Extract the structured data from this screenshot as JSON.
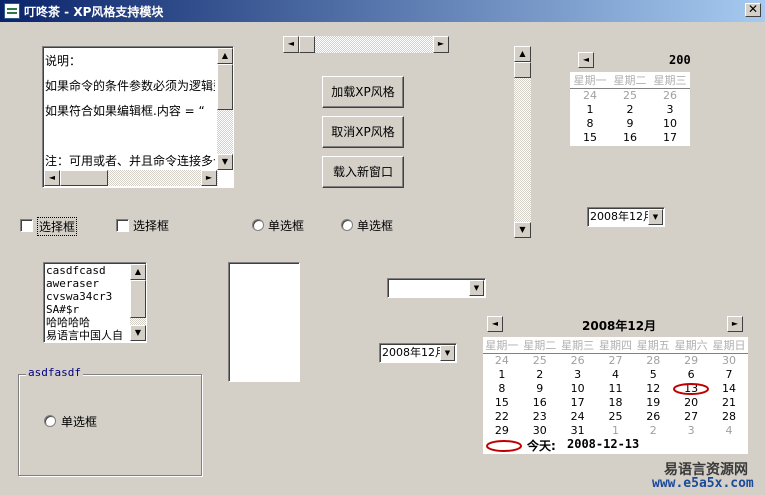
{
  "window": {
    "title": "叮咚茶 - XP风格支持模块",
    "close": "✕"
  },
  "textarea": {
    "lines": [
      "说明：",
      "如果命令的条件参数必须为逻辑型",
      "如果符合如果编辑框.内容 = “",
      "",
      "注：可用或者、并且命令连接多个"
    ]
  },
  "buttons": {
    "load_xp": "加载XP风格",
    "cancel_xp": "取消XP风格",
    "load_window": "载入新窗口"
  },
  "checkboxes": [
    "选择框",
    "选择框"
  ],
  "radios": [
    "单选框",
    "单选框"
  ],
  "listbox": {
    "items": [
      "casdfcasd",
      "aweraser",
      "cvswa34cr3",
      "SA#$r",
      "哈哈哈哈",
      "易语言中国人自"
    ]
  },
  "groupbox": {
    "label": "asdfasdf",
    "radio": "单选框"
  },
  "combos": {
    "date_right": "2008年12月",
    "date_mid": "2008年12月",
    "empty": ""
  },
  "cal_small": {
    "year_partial": "200",
    "prev": "◄",
    "weekdays": [
      "星期一",
      "星期二",
      "星期三"
    ],
    "rows": [
      [
        "24",
        "25",
        "26"
      ],
      [
        "1",
        "2",
        "3"
      ],
      [
        "8",
        "9",
        "10"
      ],
      [
        "15",
        "16",
        "17"
      ]
    ]
  },
  "cal_big": {
    "title": "2008年12月",
    "prev": "◄",
    "next": "►",
    "weekdays": [
      "星期一",
      "星期二",
      "星期三",
      "星期四",
      "星期五",
      "星期六",
      "星期日"
    ],
    "rows": [
      [
        "24",
        "25",
        "26",
        "27",
        "28",
        "29",
        "30"
      ],
      [
        "1",
        "2",
        "3",
        "4",
        "5",
        "6",
        "7"
      ],
      [
        "8",
        "9",
        "10",
        "11",
        "12",
        "13",
        "14"
      ],
      [
        "15",
        "16",
        "17",
        "18",
        "19",
        "20",
        "21"
      ],
      [
        "22",
        "23",
        "24",
        "25",
        "26",
        "27",
        "28"
      ],
      [
        "29",
        "30",
        "31",
        "1",
        "2",
        "3",
        "4"
      ]
    ],
    "today_label": "今天:",
    "today_value": "2008-12-13",
    "selected_day": "13",
    "circle_color": "#c00000"
  },
  "watermark": {
    "text": "易语言资源网",
    "site": "www.e5a5x.com"
  },
  "colors": {
    "titlebar": "#0a246a",
    "face": "#d4d0c8"
  }
}
